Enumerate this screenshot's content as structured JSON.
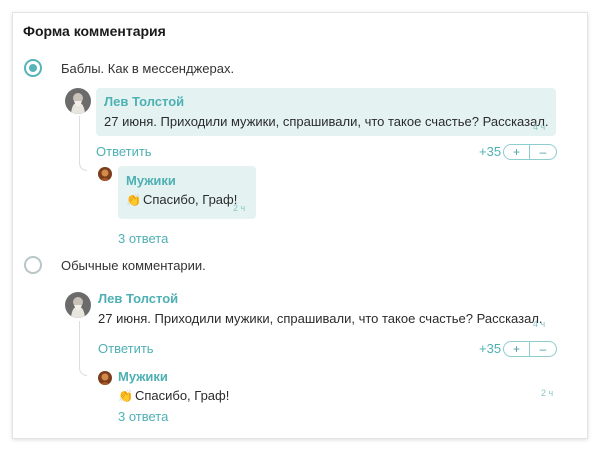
{
  "form": {
    "title": "Форма комментария"
  },
  "options": [
    {
      "label": "Баблы. Как в мессенджерах.",
      "selected": true,
      "comment": {
        "author": "Лев Толстой",
        "text": "27 июня. Приходили мужики, спрашивали, что такое счастье? Рассказал.",
        "time": "4 ч",
        "reply_link": "Ответить",
        "score": "+35",
        "plus": "+",
        "minus": "–"
      },
      "reply": {
        "author": "Мужики",
        "emoji": "👏",
        "text": "Спасибо, Граф!",
        "time": "2 ч"
      },
      "answers_link": "3 ответа"
    },
    {
      "label": "Обычные комментарии.",
      "selected": false,
      "comment": {
        "author": "Лев Толстой",
        "text": "27 июня. Приходили мужики, спрашивали, что такое счастье? Рассказал.",
        "time": "4 ч",
        "reply_link": "Ответить",
        "score": "+35",
        "plus": "+",
        "minus": "–"
      },
      "reply": {
        "author": "Мужики",
        "emoji": "👏",
        "text": "Спасибо, Граф!",
        "time": "2 ч"
      },
      "answers_link": "3 ответа"
    }
  ],
  "colors": {
    "accent": "#4eb0b3",
    "bubble": "#e4f3f2",
    "radio_on": "#57b4b7"
  },
  "icons": {
    "author_avatar": "tolstoy-portrait",
    "reply_avatar": "peasant-portrait"
  }
}
